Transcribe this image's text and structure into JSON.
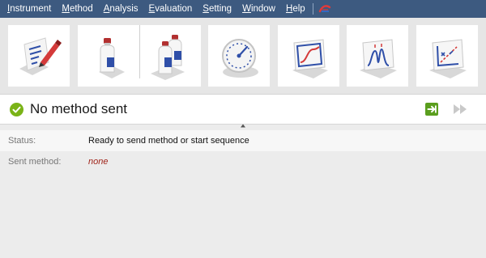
{
  "menu": {
    "items": [
      {
        "label": "Instrument",
        "mnemonic_index": 0
      },
      {
        "label": "Method",
        "mnemonic_index": 0
      },
      {
        "label": "Analysis",
        "mnemonic_index": 0
      },
      {
        "label": "Evaluation",
        "mnemonic_index": 0
      },
      {
        "label": "Setting",
        "mnemonic_index": 0
      },
      {
        "label": "Window",
        "mnemonic_index": 0
      },
      {
        "label": "Help",
        "mnemonic_index": 0
      }
    ]
  },
  "toolbar": {
    "buttons": [
      {
        "icon": "method-edit-icon"
      },
      {
        "icon": "single-analysis-icon"
      },
      {
        "icon": "batch-analysis-icon"
      },
      {
        "icon": "gauge-icon"
      },
      {
        "icon": "curve-chart-icon"
      },
      {
        "icon": "chromatogram-icon"
      },
      {
        "icon": "calibration-icon"
      }
    ]
  },
  "status": {
    "title": "No method sent",
    "colors": {
      "ok": "#7ab317",
      "send": "#5a9e1e",
      "disabled": "#c9c9c9"
    }
  },
  "details": {
    "status_label": "Status:",
    "status_value": "Ready to send method or start sequence",
    "method_label": "Sent method:",
    "method_value": "none"
  },
  "colors": {
    "menubar": "#3d5a80",
    "icon_blue": "#2f4fa8",
    "icon_red": "#d43a3a"
  }
}
